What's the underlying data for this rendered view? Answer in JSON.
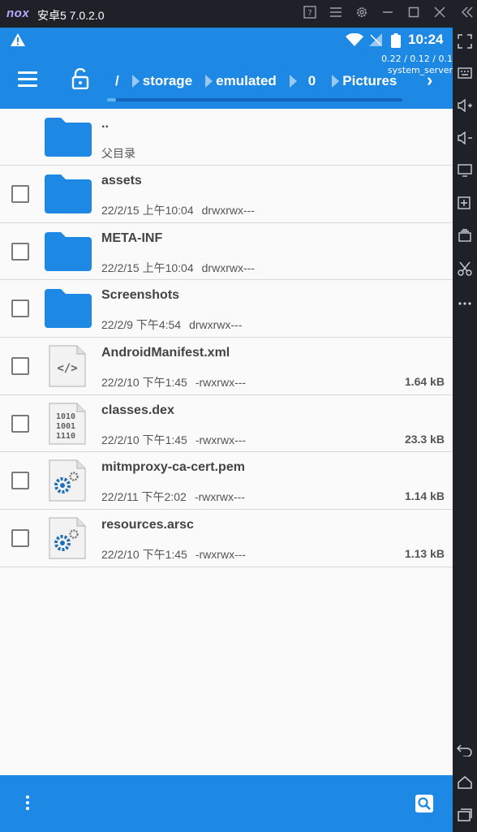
{
  "emulator": {
    "logo": "nox",
    "title": "安卓5 7.0.2.0"
  },
  "status_bar": {
    "time": "10:24"
  },
  "debug_overlay": {
    "load": "0.22 / 0.12 / 0.1",
    "process": "system_server"
  },
  "toolbar": {
    "breadcrumbs": [
      "/",
      "storage",
      "emulated",
      "0",
      "Pictures"
    ],
    "next_glyph": "›",
    "progress": 0.03
  },
  "parent_row": {
    "name": "..",
    "label": "父目录"
  },
  "files": [
    {
      "name": "assets",
      "date": "22/2/15 上午10:04",
      "perm": "drwxrwx---",
      "size": "",
      "icon": "folder-icon"
    },
    {
      "name": "META-INF",
      "date": "22/2/15 上午10:04",
      "perm": "drwxrwx---",
      "size": "",
      "icon": "folder-icon"
    },
    {
      "name": "Screenshots",
      "date": "22/2/9 下午4:54",
      "perm": "drwxrwx---",
      "size": "",
      "icon": "folder-icon"
    },
    {
      "name": "AndroidManifest.xml",
      "date": "22/2/10 下午1:45",
      "perm": "-rwxrwx---",
      "size": "1.64 kB",
      "icon": "xml-file-icon"
    },
    {
      "name": "classes.dex",
      "date": "22/2/10 下午1:45",
      "perm": "-rwxrwx---",
      "size": "23.3 kB",
      "icon": "binary-file-icon"
    },
    {
      "name": "mitmproxy-ca-cert.pem",
      "date": "22/2/11 下午2:02",
      "perm": "-rwxrwx---",
      "size": "1.14 kB",
      "icon": "settings-file-icon"
    },
    {
      "name": "resources.arsc",
      "date": "22/2/10 下午1:45",
      "perm": "-rwxrwx---",
      "size": "1.13 kB",
      "icon": "settings-file-icon"
    }
  ],
  "colors": {
    "primary": "#1e88e5",
    "folder": "#1e88e5",
    "emulator_chrome": "#1f2129"
  }
}
